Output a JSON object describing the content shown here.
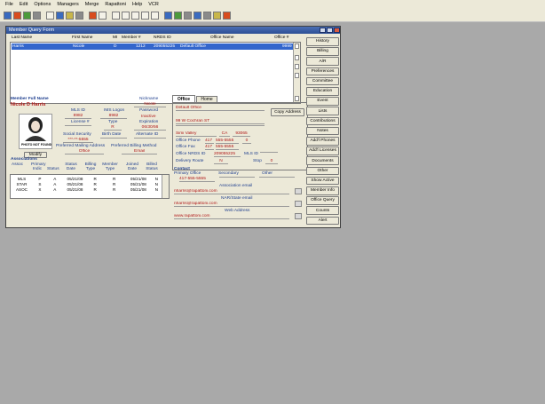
{
  "menu": [
    "File",
    "Edit",
    "Options",
    "Managers",
    "Merge",
    "Rapattoni",
    "Help",
    "VCR"
  ],
  "window": {
    "title": "Member Query Form"
  },
  "list": {
    "headers": [
      "Last Name",
      "First Name",
      "MI",
      "Member #",
      "NRDS ID",
      "Office Name",
      "Office #"
    ],
    "rows": [
      {
        "last": "Harris",
        "first": "Nicole",
        "mi": "D",
        "member": "1212",
        "nrds": "209055225",
        "office_name": "Default Office",
        "office": "9999"
      }
    ]
  },
  "member": {
    "heading": "Member Full Name",
    "full_name": "Nicole D Harris",
    "nickname_label": "Nickname",
    "nickname": "Nicole",
    "password_label": "Password",
    "status_label": "Inactive",
    "mls_id_label": "MLS ID",
    "mls_id": "8982",
    "ims_logon_label": "IMS Logon",
    "ims_logon": "8982",
    "expiration_label": "Expiration",
    "expiration": "06/30/56",
    "license_label": "License #",
    "type_label": "Type",
    "type": "R",
    "ssn_label": "Social Security",
    "ssn": "***-**-5555",
    "birth_label": "Birth Date",
    "alt_id_label": "Alternate ID",
    "photo_text": "PHOTO NOT FOUND",
    "modify": "Modify",
    "pref_mail_label": "Preferred Mailing Address",
    "pref_mail": "Office",
    "pref_bill_label": "Preferred Billing Method",
    "pref_bill": "Email"
  },
  "associations": {
    "heading": "Associations",
    "headers": [
      "Assoc",
      "Primary Indic",
      "Status",
      "Status Date",
      "Billing Type",
      "Member Type",
      "Joined Date",
      "Billed Status"
    ],
    "rows": [
      [
        "MLS",
        "P",
        "A",
        "05/21/08",
        "R",
        "R",
        "05/21/08",
        "N"
      ],
      [
        "STAR",
        "S",
        "A",
        "05/21/08",
        "R",
        "R",
        "05/21/08",
        "N"
      ],
      [
        "ASOC",
        "X",
        "A",
        "05/21/08",
        "R",
        "R",
        "05/21/08",
        "N"
      ]
    ]
  },
  "tabs": [
    "Office",
    "Home"
  ],
  "office": {
    "name": "Default Office",
    "copy_button": "Copy Address",
    "address": "99 W Cochran ST",
    "city": "Simi Valley",
    "state": "CA",
    "zip": "93065",
    "phone_label": "Office Phone",
    "phone_area": "417",
    "phone": "555-5555",
    "phone_ext": "0",
    "fax_label": "Office Fax",
    "fax_area": "417",
    "fax": "555-5555",
    "nrds_label": "Office NRDS ID",
    "nrds": "209055225",
    "mls_id_label": "MLS ID",
    "route_label": "Delivery Route",
    "route": "N",
    "stop_label": "Stop",
    "stop": "0"
  },
  "contact": {
    "heading": "Contact",
    "primary_office_label": "Primary Office",
    "primary_office": "417-555-5555",
    "secondary_label": "Secondary",
    "other_label": "Other",
    "assoc_email_label": "Association email",
    "assoc_email": "nharris@rapattoni.com",
    "nar_email_label": "NAR/State email",
    "nar_email": "nharris@rapattoni.com",
    "web_label": "Web Address",
    "web": "www.rapattoni.com"
  },
  "side_buttons": [
    "History",
    "Billing",
    "A/R",
    "Preferences",
    "Committee",
    "Education",
    "Event",
    "Lists",
    "Contributions",
    "Notes",
    "Add'l Phones",
    "Add'l Licenses",
    "Documents",
    "Other",
    "Show Active",
    "Member Info",
    "Office Query",
    "Counts",
    "Alert"
  ]
}
